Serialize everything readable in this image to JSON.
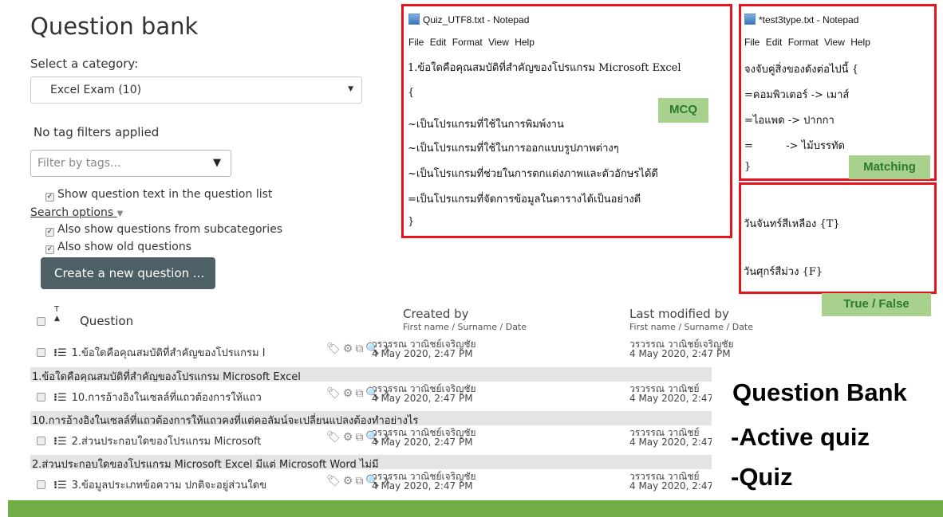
{
  "bank": {
    "title": "Question bank",
    "category_label": "Select a category:",
    "category_value": "Excel Exam (10)",
    "no_tags": "No tag filters applied",
    "tag_placeholder": "Filter by tags...",
    "show_text": "Show question text in the question list",
    "search_options": "Search options",
    "show_sub": "Also show questions from subcategories",
    "show_old": "Also show old questions",
    "create_btn": "Create a new question ...",
    "col_t": "T",
    "col_question": "Question",
    "col_created": "Created by",
    "col_modified": "Last modified by",
    "col_sub": "First name / Surname / Date",
    "rows": [
      {
        "q": "1.ข้อใดคือคุณสมบัติที่สำคัญของโปรแกรม I",
        "created_name": "วรวรรณ วาณิชย์เจริญชัย",
        "created_date": "4 May 2020, 2:47 PM",
        "mod_name": "วรวรรณ วาณิชย์เจริญชัย",
        "mod_date": "4 May 2020, 2:47 PM",
        "full": "1.ข้อใดคือคุณสมบัติที่สำคัญของโปรแกรม Microsoft Excel"
      },
      {
        "q": "10.การอ้างอิงในเซลล์ที่แถวต้องการให้แถว",
        "created_name": "วรวรรณ วาณิชย์เจริญชัย",
        "created_date": "4 May 2020, 2:47 PM",
        "mod_name": "วรวรรณ วาณิชย์",
        "mod_date": "4 May 2020, 2:47",
        "full": "10.การอ้างอิงในเซลล์ที่แถวต้องการให้แถวคงที่แต่คอลัมน์จะเปลี่ยนแปลงต้องทำอย่างไร"
      },
      {
        "q": "2.ส่วนประกอบใดของโปรแกรม Microsoft",
        "created_name": "วรวรรณ วาณิชย์เจริญชัย",
        "created_date": "4 May 2020, 2:47 PM",
        "mod_name": "วรวรรณ วาณิชย์",
        "mod_date": "4 May 2020, 2:47",
        "full": "2.ส่วนประกอบใดของโปรแกรม Microsoft Excel มีแต่ Microsoft Word ไม่มี"
      },
      {
        "q": "3.ข้อมูลประเภทข้อความ ปกติจะอยู่ส่วนใดข",
        "created_name": "วรวรรณ วาณิชย์เจริญชัย",
        "created_date": "4 May 2020, 2:47 PM",
        "mod_name": "วรวรรณ วาณิชย์",
        "mod_date": "4 May 2020, 2:47",
        "full": ""
      }
    ]
  },
  "notepad1": {
    "title": "Quiz_UTF8.txt - Notepad",
    "menu": [
      "File",
      "Edit",
      "Format",
      "View",
      "Help"
    ],
    "lines": [
      "1.ข้อใดคือคุณสมบัติที่สำคัญของโปรแกรม Microsoft Excel",
      "{",
      "~เป็นโปรแกรมที่ใช้ในการพิมพ์งาน",
      "~เป็นโปรแกรมที่ใช้ในการออกแบบรูปภาพต่างๆ",
      "~เป็นโปรแกรมที่ช่วยในการตกแต่งภาพและตัวอักษรได้ดี",
      "=เป็นโปรแกรมที่จัดการข้อมูลในตารางได้เป็นอย่างดี",
      "}"
    ],
    "tag": "MCQ"
  },
  "notepad2": {
    "title": "*test3type.txt - Notepad",
    "menu": [
      "File",
      "Edit",
      "Format",
      "View",
      "Help"
    ],
    "lines": [
      "จงจับคู่สิ่งของดังต่อไปนี้ {",
      "=คอมพิวเตอร์ -> เมาส์",
      "=ไอแพด -> ปากกา",
      "=          -> ไม้บรรทัด",
      "}"
    ],
    "tag": "Matching",
    "tf_lines": [
      "วันจันทร์สีเหลือง {T}",
      "วันศุกร์สีม่วง {F}"
    ],
    "tf_tag": "True / False"
  },
  "overlay": [
    "Question Bank",
    "-Active quiz",
    "-Quiz"
  ],
  "colors": {
    "red": "#e6141e",
    "green_tag": "#a9d18e",
    "green_bar": "#70ad47",
    "button": "#4d6066"
  }
}
